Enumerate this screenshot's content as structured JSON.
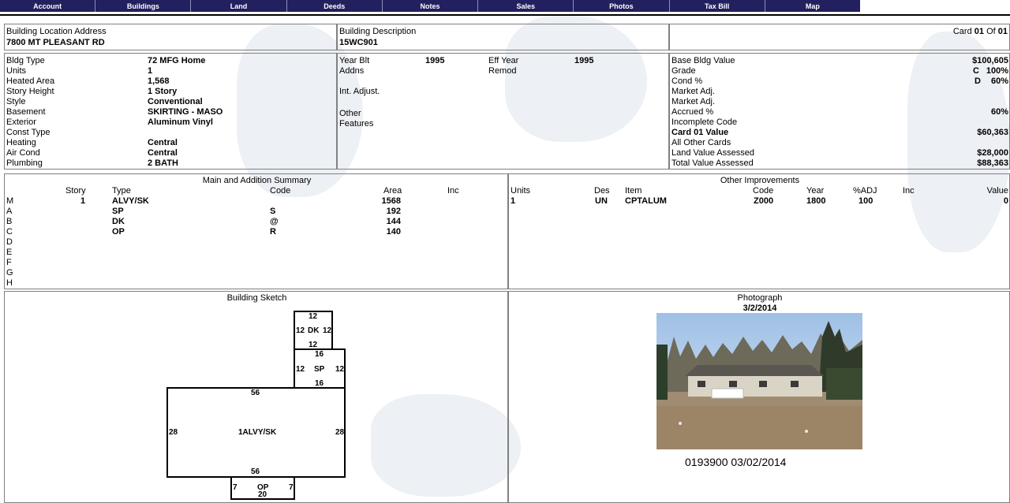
{
  "nav": {
    "tabs": [
      "Account",
      "Buildings",
      "Land",
      "Deeds",
      "Notes",
      "Sales",
      "Photos",
      "Tax Bill",
      "Map"
    ]
  },
  "location": {
    "label": "Building Location Address",
    "value": "7800 MT PLEASANT RD"
  },
  "description": {
    "label": "Building Description",
    "value": "15WC901"
  },
  "card": {
    "label": "Card",
    "current": "01",
    "of_label": "Of",
    "total": "01"
  },
  "building": {
    "labels": [
      "Bldg Type",
      "Units",
      "Heated Area",
      "Story Height",
      "Style",
      "Basement",
      "Exterior",
      "Const Type",
      "Heating",
      "Air Cond",
      "Plumbing"
    ],
    "values": [
      "72  MFG Home",
      "1",
      "1,568",
      "1 Story",
      "Conventional",
      "SKIRTING - MASO",
      "Aluminum Vinyl",
      "",
      "Central",
      "Central",
      "2 BATH"
    ]
  },
  "years": {
    "year_blt_label": "Year Blt",
    "year_blt": "1995",
    "eff_year_label": "Eff Year",
    "eff_year": "1995",
    "addns_label": "Addns",
    "remod_label": "Remod",
    "int_adjust_label": "Int. Adjust.",
    "other_label": "Other",
    "features_label": "Features"
  },
  "values_panel": {
    "labels": [
      "Base Bldg Value",
      "Grade",
      "Cond %",
      "Market Adj.",
      "Market Adj.",
      "Accrued %",
      "Incomplete Code",
      "Card 01 Value",
      "All Other Cards",
      "Land Value Assessed",
      "Total Value Assessed"
    ],
    "values": [
      "$100,605",
      "100%",
      "60%",
      "",
      "",
      "60%",
      "",
      "$60,363",
      "",
      "$28,000",
      "$88,363"
    ],
    "grade_code": "C",
    "cond_code": "D"
  },
  "main_summary": {
    "title": "Main and Addition Summary",
    "headers": {
      "story": "Story",
      "type": "Type",
      "code": "Code",
      "area": "Area",
      "inc": "Inc"
    },
    "row_letters": [
      "M",
      "A",
      "B",
      "C",
      "D",
      "E",
      "F",
      "G",
      "H"
    ],
    "rows": [
      {
        "story": "1",
        "type": "ALVY/SK",
        "code": "",
        "area": "1568"
      },
      {
        "story": "",
        "type": "SP",
        "code": "S",
        "area": "192"
      },
      {
        "story": "",
        "type": "DK",
        "code": "@",
        "area": "144"
      },
      {
        "story": "",
        "type": "OP",
        "code": "R",
        "area": "140"
      }
    ]
  },
  "other_improvements": {
    "title": "Other Improvements",
    "headers": {
      "units": "Units",
      "des": "Des",
      "item": "Item",
      "code": "Code",
      "year": "Year",
      "adj": "%ADJ",
      "inc": "Inc",
      "value": "Value"
    },
    "rows": [
      {
        "units": "1",
        "des": "UN",
        "item": "CPTALUM",
        "code": "Z000",
        "year": "1800",
        "adj": "100",
        "inc": "",
        "value": "0"
      }
    ]
  },
  "sketch": {
    "title": "Building Sketch",
    "dk": {
      "top": "12",
      "left": "12",
      "label": "DK",
      "right": "12",
      "bottom": "12"
    },
    "sp": {
      "top": "16",
      "left": "12",
      "label": "SP",
      "right": "12",
      "bottom": "16"
    },
    "main": {
      "top": "56",
      "left": "28",
      "label": "1ALVY/SK",
      "right": "28",
      "bottom": "56"
    },
    "op": {
      "left": "7",
      "label": "OP",
      "right": "7",
      "bottom": "20"
    }
  },
  "photograph": {
    "title": "Photograph",
    "date": "3/2/2014",
    "caption": "0193900  03/02/2014"
  }
}
